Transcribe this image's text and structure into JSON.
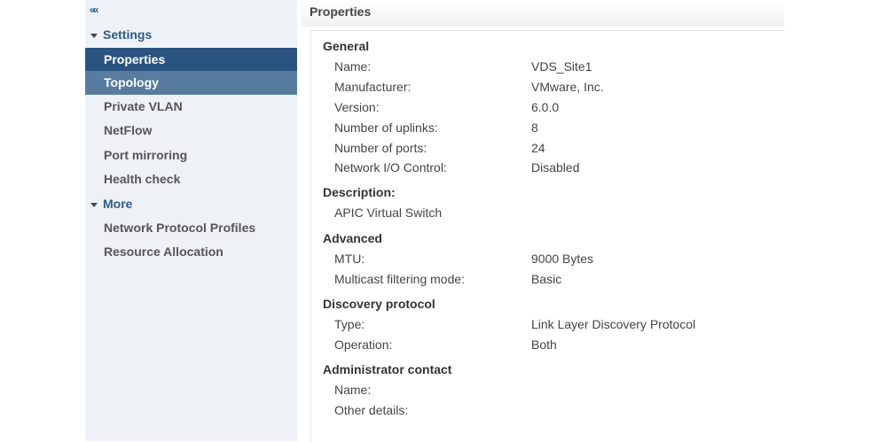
{
  "sidebar": {
    "collapse_icon": "««",
    "settings_label": "Settings",
    "settings_items": [
      {
        "label": "Properties"
      },
      {
        "label": "Topology"
      },
      {
        "label": "Private VLAN"
      },
      {
        "label": "NetFlow"
      },
      {
        "label": "Port mirroring"
      },
      {
        "label": "Health check"
      }
    ],
    "more_label": "More",
    "more_items": [
      {
        "label": "Network Protocol Profiles"
      },
      {
        "label": "Resource Allocation"
      }
    ]
  },
  "main": {
    "title": "Properties",
    "general": {
      "heading": "General",
      "rows": [
        {
          "label": "Name:",
          "value": "VDS_Site1"
        },
        {
          "label": "Manufacturer:",
          "value": "VMware, Inc."
        },
        {
          "label": "Version:",
          "value": "6.0.0"
        },
        {
          "label": "Number of uplinks:",
          "value": "8"
        },
        {
          "label": "Number of ports:",
          "value": "24"
        },
        {
          "label": "Network I/O Control:",
          "value": "Disabled"
        }
      ]
    },
    "description": {
      "heading": "Description:",
      "text": "APIC Virtual Switch"
    },
    "advanced": {
      "heading": "Advanced",
      "rows": [
        {
          "label": "MTU:",
          "value": "9000 Bytes"
        },
        {
          "label": "Multicast filtering mode:",
          "value": "Basic"
        }
      ]
    },
    "discovery": {
      "heading": "Discovery protocol",
      "rows": [
        {
          "label": "Type:",
          "value": "Link Layer Discovery Protocol"
        },
        {
          "label": "Operation:",
          "value": "Both"
        }
      ]
    },
    "admin": {
      "heading": "Administrator contact",
      "rows": [
        {
          "label": "Name:",
          "value": ""
        },
        {
          "label": "Other details:",
          "value": ""
        }
      ]
    }
  }
}
